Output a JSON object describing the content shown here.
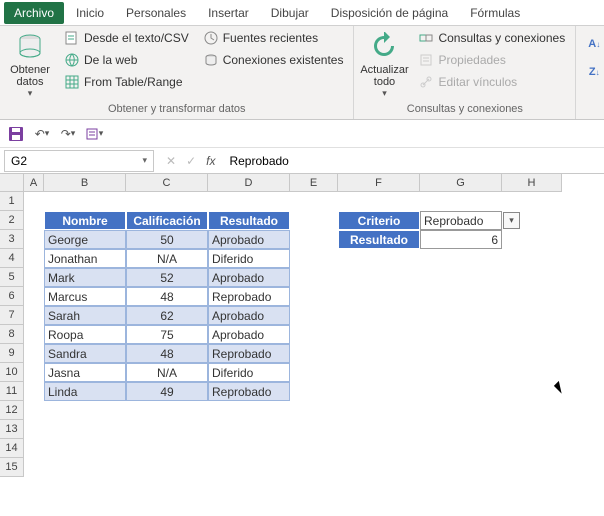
{
  "tabs": [
    "Archivo",
    "Inicio",
    "Personales",
    "Insertar",
    "Dibujar",
    "Disposición de página",
    "Fórmulas"
  ],
  "ribbon": {
    "g1": {
      "obtener": "Obtener\ndatos",
      "desde_csv": "Desde el texto/CSV",
      "de_la_web": "De la web",
      "from_table": "From Table/Range",
      "fuentes": "Fuentes recientes",
      "conexiones": "Conexiones existentes",
      "label": "Obtener y transformar datos"
    },
    "g2": {
      "actualizar": "Actualizar\ntodo",
      "consultas": "Consultas y conexiones",
      "propiedades": "Propiedades",
      "editar": "Editar vínculos",
      "label": "Consultas y conexiones"
    }
  },
  "formula": {
    "namebox": "G2",
    "value": "Reprobado"
  },
  "cols": [
    {
      "l": "A",
      "w": 20
    },
    {
      "l": "B",
      "w": 82
    },
    {
      "l": "C",
      "w": 82
    },
    {
      "l": "D",
      "w": 82
    },
    {
      "l": "E",
      "w": 48
    },
    {
      "l": "F",
      "w": 82
    },
    {
      "l": "G",
      "w": 82
    },
    {
      "l": "H",
      "w": 60
    }
  ],
  "rows": 15,
  "table": {
    "headers": [
      "Nombre",
      "Calificación",
      "Resultado"
    ],
    "data": [
      [
        "George",
        "50",
        "Aprobado"
      ],
      [
        "Jonathan",
        "N/A",
        "Diferido"
      ],
      [
        "Mark",
        "52",
        "Aprobado"
      ],
      [
        "Marcus",
        "48",
        "Reprobado"
      ],
      [
        "Sarah",
        "62",
        "Aprobado"
      ],
      [
        "Roopa",
        "75",
        "Aprobado"
      ],
      [
        "Sandra",
        "48",
        "Reprobado"
      ],
      [
        "Jasna",
        "N/A",
        "Diferido"
      ],
      [
        "Linda",
        "49",
        "Reprobado"
      ]
    ]
  },
  "criteria": {
    "h1": "Criterio",
    "v1": "Reprobado",
    "h2": "Resultado",
    "v2": "6"
  }
}
